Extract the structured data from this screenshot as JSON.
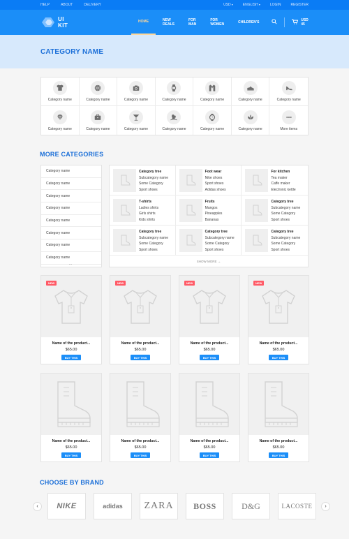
{
  "topbar": {
    "left": [
      "HELP",
      "ABOUT",
      "DELIVERY"
    ],
    "currency": "USD",
    "language": "ENGLISH",
    "login": "LOGIN",
    "register": "REGISTER"
  },
  "navbar": {
    "logo": "UI KIT",
    "items": [
      "HOME",
      "NEW DEALS",
      "FOR MAN",
      "FOR WOMEN",
      "CHILDREN'S"
    ],
    "active": "HOME",
    "cart_total": "USD 45"
  },
  "hero": {
    "title": "CATEGORY NAME"
  },
  "categories": [
    {
      "label": "Category name",
      "icon": "tshirt-icon"
    },
    {
      "label": "Category name",
      "icon": "basketball-icon"
    },
    {
      "label": "Category name",
      "icon": "camera-icon"
    },
    {
      "label": "Category name",
      "icon": "watch-icon"
    },
    {
      "label": "Category name",
      "icon": "jacket-icon"
    },
    {
      "label": "Category name",
      "icon": "sneaker-icon"
    },
    {
      "label": "Category name",
      "icon": "high-heel-icon"
    },
    {
      "label": "Category name",
      "icon": "diamond-icon"
    },
    {
      "label": "Category name",
      "icon": "briefcase-icon"
    },
    {
      "label": "Category name",
      "icon": "cocktail-icon"
    },
    {
      "label": "Category name",
      "icon": "rocking-horse-icon"
    },
    {
      "label": "Category name",
      "icon": "wristwatch-icon"
    },
    {
      "label": "Category name",
      "icon": "plant-icon"
    },
    {
      "label": "More items",
      "icon": "more-dots-icon"
    }
  ],
  "more_categories": {
    "title": "MORE CATEGORIES",
    "side_items": [
      "Category name",
      "Category name",
      "Category name",
      "Category name",
      "Category name",
      "Category name",
      "Category name",
      "Category name"
    ],
    "side_more": "...",
    "panels": [
      {
        "title": "Category tree",
        "items": [
          "Subcategory name",
          "Some Category",
          "Sport shoes"
        ]
      },
      {
        "title": "Foot wear",
        "items": [
          "Nike shoes",
          "Sport shoes",
          "Adidas shoes"
        ]
      },
      {
        "title": "For kitchen",
        "items": [
          "Tea maker",
          "Caffe maker",
          "Electronic kettle"
        ]
      },
      {
        "title": "T-shirts",
        "items": [
          "Ladies shirts",
          "Girls shirts",
          "Kids shirts"
        ]
      },
      {
        "title": "Fruits",
        "items": [
          "Mangos",
          "Pineapples",
          "Bananas"
        ]
      },
      {
        "title": "Category tree",
        "items": [
          "Subcategory name",
          "Some Category",
          "Sport shoes"
        ]
      },
      {
        "title": "Category tree",
        "items": [
          "Subcategory name",
          "Some Category",
          "Sport shoes"
        ]
      },
      {
        "title": "Category tree",
        "items": [
          "Subcategory name",
          "Some Category",
          "Sport shoes"
        ]
      },
      {
        "title": "Category tree",
        "items": [
          "Subcategory name",
          "Some Category",
          "Sport shoes"
        ]
      }
    ],
    "show_more": "SHOW MORE →"
  },
  "products": [
    {
      "name": "Name of the product...",
      "price": "$65.00",
      "button": "BUY THIS",
      "badge": "NEW",
      "image": "tshirt"
    },
    {
      "name": "Name of the product...",
      "price": "$65.00",
      "button": "BUY THIS",
      "badge": "NEW",
      "image": "tshirt"
    },
    {
      "name": "Name of the product...",
      "price": "$65.00",
      "button": "BUY THIS",
      "badge": "NEW",
      "image": "tshirt"
    },
    {
      "name": "Name of the product...",
      "price": "$65.00",
      "button": "BUY THIS",
      "badge": "NEW",
      "image": "tshirt"
    },
    {
      "name": "Name of the product...",
      "price": "$65.00",
      "button": "BUY THIS",
      "badge": "",
      "image": "boot"
    },
    {
      "name": "Name of the product...",
      "price": "$65.00",
      "button": "BUY THIS",
      "badge": "",
      "image": "boot"
    },
    {
      "name": "Name of the product...",
      "price": "$65.00",
      "button": "BUY THIS",
      "badge": "",
      "image": "boot"
    },
    {
      "name": "Name of the product...",
      "price": "$65.00",
      "button": "BUY THIS",
      "badge": "",
      "image": "boot"
    }
  ],
  "brands": {
    "title": "CHOOSE BY BRAND",
    "items": [
      "NIKE",
      "adidas",
      "ZARA",
      "BOSS",
      "D&G",
      "LACOSTE"
    ],
    "prev": "‹",
    "next": "›"
  },
  "colors": {
    "primary": "#1b8ef8",
    "topbar": "#0a7cf5",
    "accent": "#ffd89a",
    "badge": "#ff5a66"
  }
}
